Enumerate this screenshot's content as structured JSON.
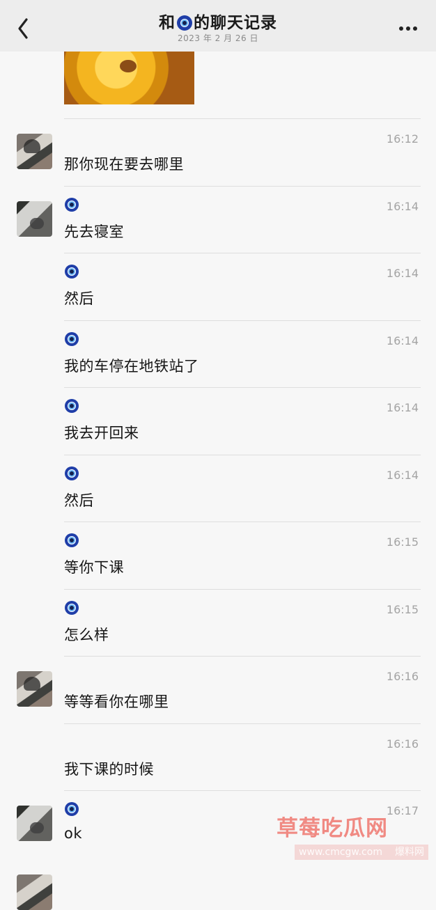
{
  "header": {
    "title_prefix": "和",
    "title_suffix": "的聊天记录",
    "subtitle": "2023 年 2 月 26 日",
    "back_icon": "chevron-left-icon",
    "more_icon": "more-icon"
  },
  "messages": [
    {
      "time": "16:12",
      "text": "那你现在要去哪里"
    },
    {
      "time": "16:14",
      "text": "先去寝室"
    },
    {
      "time": "16:14",
      "text": "然后"
    },
    {
      "time": "16:14",
      "text": "我的车停在地铁站了"
    },
    {
      "time": "16:14",
      "text": "我去开回来"
    },
    {
      "time": "16:14",
      "text": "然后"
    },
    {
      "time": "16:15",
      "text": "等你下课"
    },
    {
      "time": "16:15",
      "text": "怎么样"
    },
    {
      "time": "16:16",
      "text": "等等看你在哪里"
    },
    {
      "time": "16:16",
      "text": "我下课的时候"
    },
    {
      "time": "16:17",
      "text": "ok"
    }
  ],
  "watermark": {
    "main": "草莓吃瓜网",
    "sub_left": "www.cmcgw.com",
    "sub_right": "爆料网"
  },
  "colors": {
    "header_bg": "#ededed",
    "page_bg": "#f7f7f7",
    "evil_eye": "#1f3ea8",
    "watermark": "#ef6f67"
  }
}
